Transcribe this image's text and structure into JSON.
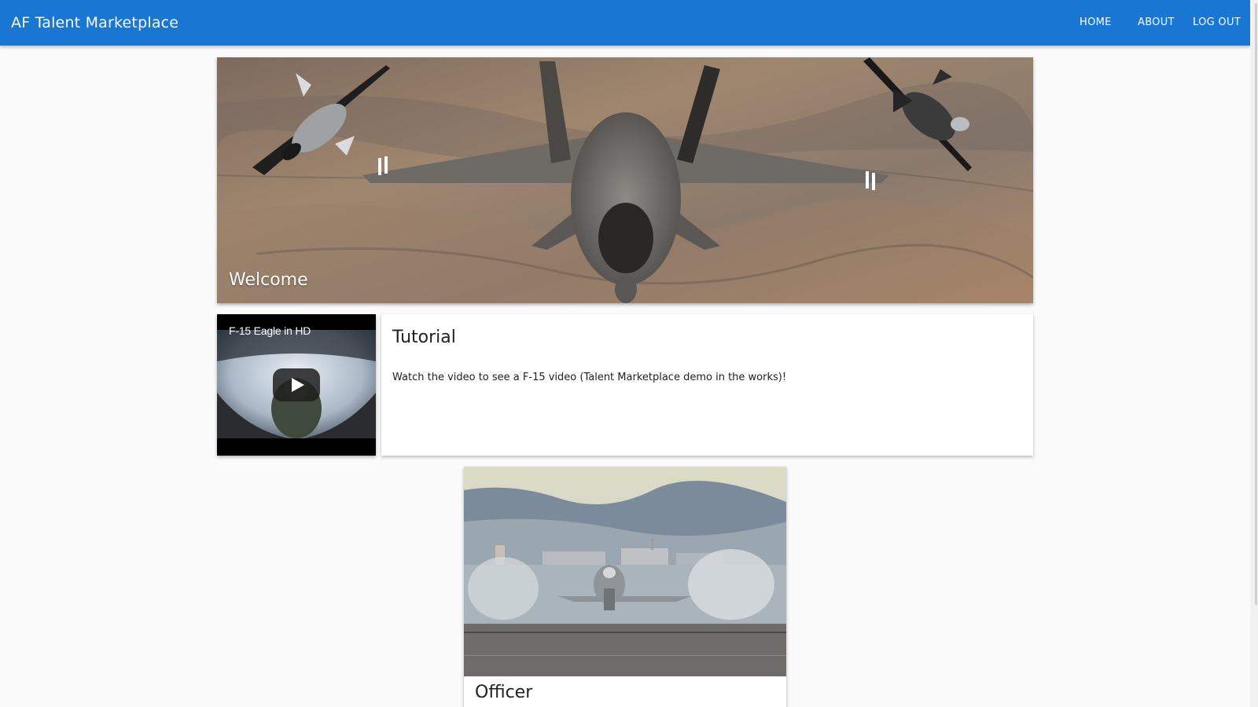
{
  "app": {
    "title": "AF Talent Marketplace",
    "accent_color": "#1976d2"
  },
  "nav": {
    "home": "HOME",
    "about": "ABOUT",
    "logout": "LOG OUT"
  },
  "hero": {
    "title": "Welcome"
  },
  "video": {
    "title": "F-15 Eagle in HD",
    "icon": "play-icon"
  },
  "tutorial": {
    "title": "Tutorial",
    "text": "Watch the video to see a F-15 video (Talent Marketplace demo in the works)!"
  },
  "officer": {
    "title": "Officer"
  }
}
